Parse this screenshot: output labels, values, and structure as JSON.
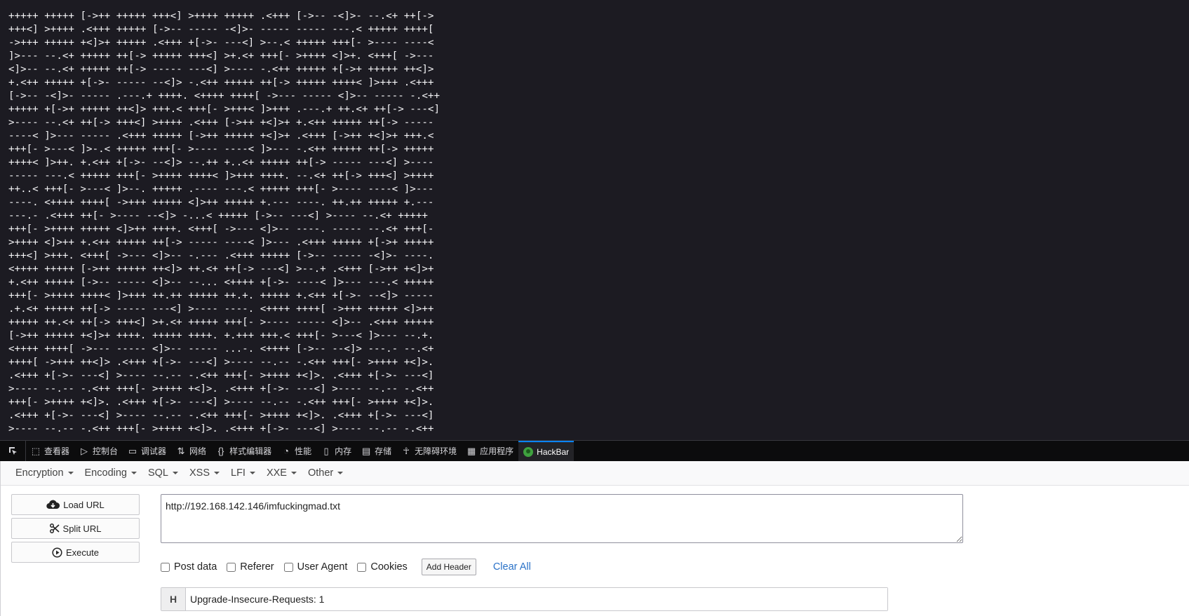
{
  "content": {
    "text": "+++++ +++++ [->++ +++++ +++<] >++++ +++++ .<+++ [->-- -<]>- --.<+ ++[->\n+++<] >++++ .<+++ +++++ [->-- ----- -<]>- ----- ----- ---.< +++++ ++++[\n->+++ +++++ +<]>+ +++++ .<+++ +[->- ---<] >--.< +++++ +++[- >---- ----<\n]>--- --.<+ +++++ ++[-> +++++ +++<] >+.<+ +++[- >++++ <]>+. <+++[ ->---\n<]>-- --.<+ +++++ ++[-> ----- ---<] >---- -.<++ +++++ +[->+ +++++ ++<]>\n+.<++ +++++ +[->- ----- --<]> -.<++ +++++ ++[-> +++++ ++++< ]>+++ .<+++\n[->-- -<]>- ----- .---.+ ++++. <++++ ++++[ ->--- ----- <]>-- ----- -.<++\n+++++ +[->+ +++++ ++<]> +++.< +++[- >+++< ]>+++ .---.+ ++.<+ ++[-> ---<]\n>---- --.<+ ++[-> +++<] >++++ .<+++ [->++ +<]>+ +.<++ +++++ ++[-> -----\n----< ]>--- ----- .<+++ +++++ [->++ +++++ +<]>+ .<+++ [->++ +<]>+ +++.<\n+++[- >---< ]>-.< +++++ +++[- >---- ----< ]>--- -.<++ +++++ ++[-> +++++\n++++< ]>++. +.<++ +[->- --<]> --.++ +..<+ +++++ ++[-> ----- ---<] >----\n----- ---.< +++++ +++[- >++++ ++++< ]>+++ ++++. --.<+ ++[-> +++<] >++++\n++..< +++[- >---< ]>--. +++++ .---- ---.< +++++ +++[- >---- ----< ]>---\n----. <++++ ++++[ ->+++ +++++ <]>++ +++++ +.--- ----. ++.++ +++++ +.---\n---.- .<+++ ++[- >---- --<]> -...< +++++ [->-- ---<] >---- --.<+ +++++\n+++[- >++++ +++++ <]>++ ++++. <+++[ ->--- <]>-- ----. ----- --.<+ +++[-\n>++++ <]>++ +.<++ +++++ ++[-> ----- ----< ]>--- .<+++ +++++ +[->+ +++++\n+++<] >+++. <+++[ ->--- <]>-- -.--- .<+++ +++++ [->-- ----- -<]>- ----.\n<++++ +++++ [->++ +++++ ++<]> ++.<+ ++[-> ---<] >--.+ .<+++ [->++ +<]>+\n+.<++ +++++ [->-- ----- <]>-- --... <++++ +[->- ----< ]>--- ---.< +++++\n+++[- >++++ ++++< ]>+++ ++.++ +++++ ++.+. +++++ +.<++ +[->- --<]> -----\n.+.<+ +++++ ++[-> ----- ---<] >---- ----. <++++ ++++[ ->+++ +++++ <]>++\n+++++ ++.<+ ++[-> +++<] >+.<+ +++++ +++[- >---- ----- <]>-- .<+++ +++++\n[->++ +++++ +<]>+ ++++. +++++ ++++. +.+++ +++.< +++[- >---< ]>--- --.+.\n<++++ ++++[ ->--- ----- <]>-- ----- ...-. <++++ [->-- --<]> ---.- --.<+\n++++[ ->+++ ++<]> .<+++ +[->- ---<] >---- --.-- -.<++ +++[- >++++ +<]>.\n.<+++ +[->- ---<] >---- --.-- -.<++ +++[- >++++ +<]>. .<+++ +[->- ---<]\n>---- --.-- -.<++ +++[- >++++ +<]>. .<+++ +[->- ---<] >---- --.-- -.<++\n+++[- >++++ +<]>. .<+++ +[->- ---<] >---- --.-- -.<++ +++[- >++++ +<]>.\n.<+++ +[->- ---<] >---- --.-- -.<++ +++[- >++++ +<]>. .<+++ +[->- ---<]\n>---- --.-- -.<++ +++[- >++++ +<]>. .<+++ +[->- ---<] >---- --.-- -.<++"
  },
  "devtools": {
    "tabs": [
      {
        "label": "查看器",
        "icon": "inspector-icon"
      },
      {
        "label": "控制台",
        "icon": "console-icon"
      },
      {
        "label": "调试器",
        "icon": "debugger-icon"
      },
      {
        "label": "网络",
        "icon": "network-icon"
      },
      {
        "label": "样式编辑器",
        "icon": "style-editor-icon"
      },
      {
        "label": "性能",
        "icon": "performance-icon"
      },
      {
        "label": "内存",
        "icon": "memory-icon"
      },
      {
        "label": "存储",
        "icon": "storage-icon"
      },
      {
        "label": "无障碍环境",
        "icon": "accessibility-icon"
      },
      {
        "label": "应用程序",
        "icon": "application-icon"
      },
      {
        "label": "HackBar",
        "icon": "hackbar-icon",
        "active": true
      }
    ]
  },
  "hackbar": {
    "menu": [
      "Encryption",
      "Encoding",
      "SQL",
      "XSS",
      "LFI",
      "XXE",
      "Other"
    ],
    "buttons": {
      "load_url": "Load URL",
      "split_url": "Split URL",
      "execute": "Execute"
    },
    "url": "http://192.168.142.146/imfuckingmad.txt",
    "options": {
      "post_data": "Post data",
      "referer": "Referer",
      "user_agent": "User Agent",
      "cookies": "Cookies"
    },
    "add_header": "Add Header",
    "clear_all": "Clear All",
    "header": {
      "tag": "H",
      "value": "Upgrade-Insecure-Requests: 1"
    }
  },
  "colors": {
    "content_bg": "#1c1b22",
    "devtools_bg": "#0c0c0d",
    "active_tab_accent": "#0a84ff",
    "link": "#2a72c8"
  }
}
